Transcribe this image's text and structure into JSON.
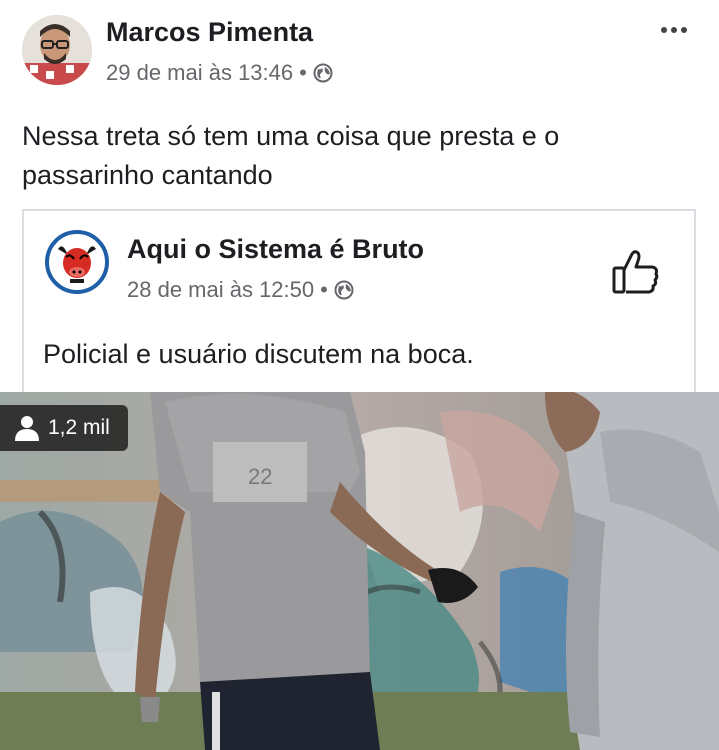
{
  "post": {
    "author": "Marcos Pimenta",
    "timestamp": "29 de mai às 13:46",
    "separator": "•",
    "privacy_icon": "globe-icon",
    "menu_icon": "more-options-icon",
    "caption": "Nessa treta só tem uma coisa que presta e o passarinho cantando"
  },
  "shared_post": {
    "page_name": "Aqui o Sistema é Bruto",
    "timestamp": "28 de mai às 12:50",
    "separator": "•",
    "privacy_icon": "globe-icon",
    "like_icon": "thumbs-up-icon",
    "text": "Policial e usuário discutem na boca."
  },
  "video": {
    "view_icon": "person-icon",
    "view_count": "1,2 mil",
    "jersey_number": "22"
  },
  "colors": {
    "text_primary": "#1c1e21",
    "text_secondary": "#65676b",
    "border": "#dadde1",
    "badge_bg": "#1e1e1e"
  }
}
